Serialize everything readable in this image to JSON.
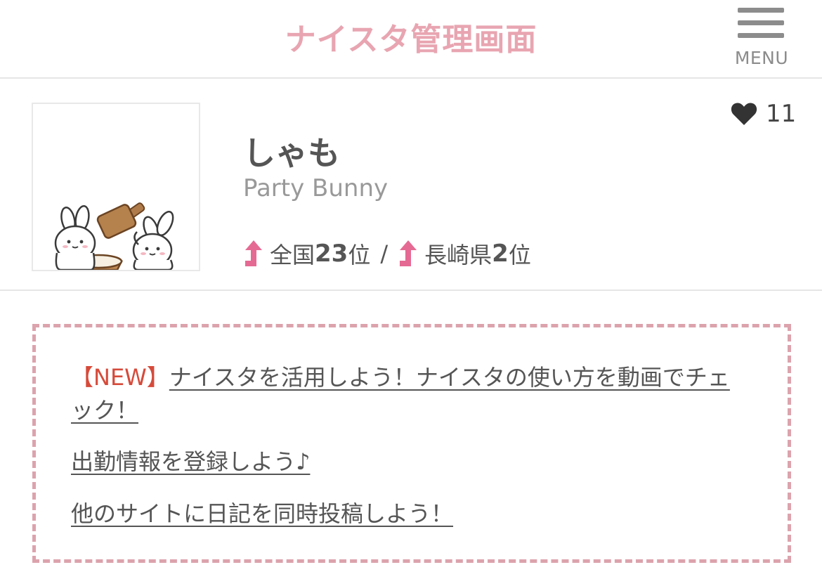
{
  "header": {
    "title": "ナイスタ管理画面",
    "menu_label": "MENU"
  },
  "profile": {
    "like_count": "11",
    "name": "しゃも",
    "shop": "Party Bunny",
    "rank_national_prefix": "全国",
    "rank_national_value": "23",
    "rank_national_suffix": "位",
    "rank_separator": "/",
    "rank_prefecture_prefix": "長崎県",
    "rank_prefecture_value": "2",
    "rank_prefecture_suffix": "位"
  },
  "notices": {
    "new_tag": "【NEW】",
    "item1": "ナイスタを活用しよう！ナイスタの使い方を動画でチェック！",
    "item2": "出勤情報を登録しよう♪",
    "item3": "他のサイトに日記を同時投稿しよう！"
  },
  "colors": {
    "accent_pink": "#e8a5b1",
    "arrow_pink": "#e56a93",
    "new_red": "#d64a3a",
    "dash_border": "#dca3ad"
  },
  "icons": {
    "menu": "hamburger-menu-icon",
    "like": "heart-icon",
    "rank_up": "rank-up-arrow-icon"
  }
}
